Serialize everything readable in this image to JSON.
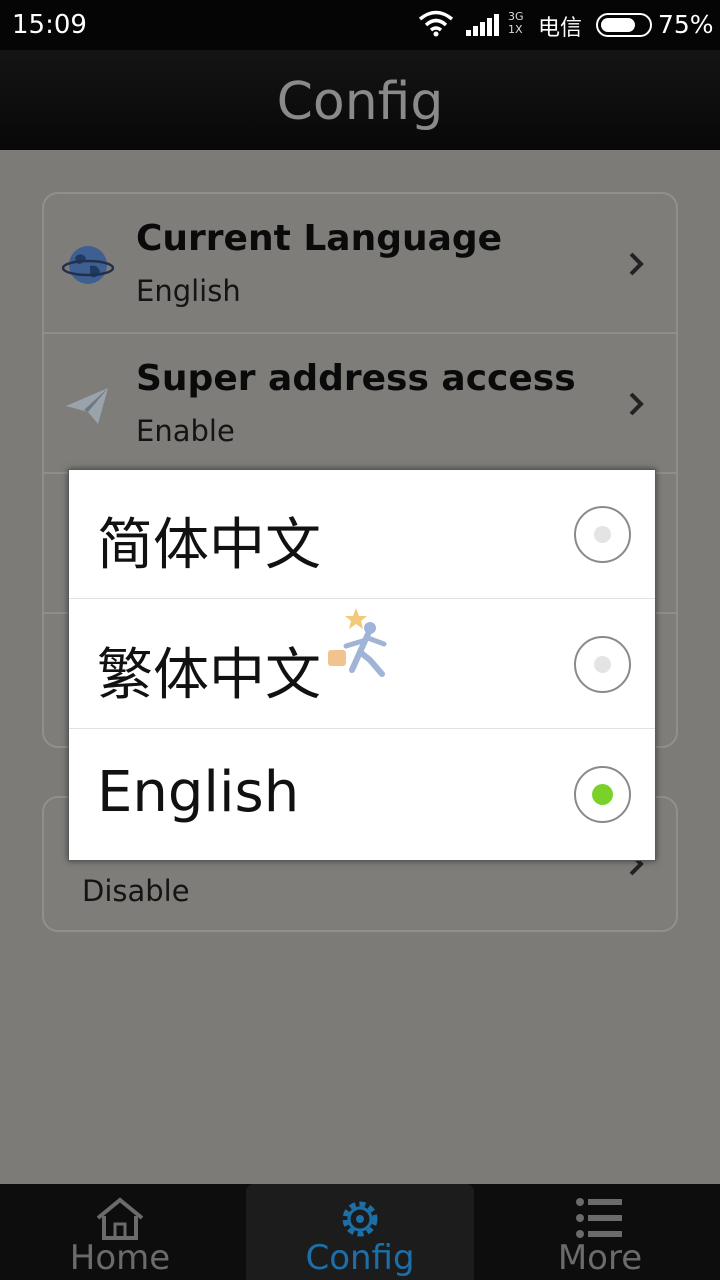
{
  "status_bar": {
    "time": "15:09",
    "network_type_top": "3G",
    "network_type_bottom": "1X",
    "carrier": "电信",
    "battery": "75%",
    "battery_level": 0.75
  },
  "header": {
    "title": "Config"
  },
  "settings": {
    "items": [
      {
        "title": "Current Language",
        "value": "English",
        "icon": "globe-icon"
      },
      {
        "title": "Super address access",
        "value": "Enable",
        "icon": "paper-plane-icon"
      }
    ],
    "section2_value": "Disable"
  },
  "language_dialog": {
    "options": [
      {
        "label": "简体中文",
        "selected": false
      },
      {
        "label": "繁体中文",
        "selected": false
      },
      {
        "label": "English",
        "selected": true
      }
    ]
  },
  "bottom_nav": {
    "items": [
      {
        "label": "Home",
        "icon": "home-icon"
      },
      {
        "label": "Config",
        "icon": "gear-icon",
        "active": true
      },
      {
        "label": "More",
        "icon": "list-icon"
      }
    ]
  },
  "colors": {
    "accent": "#1c6fa8",
    "radio_selected": "#7ad12a",
    "overlay": "#7d7b77"
  }
}
